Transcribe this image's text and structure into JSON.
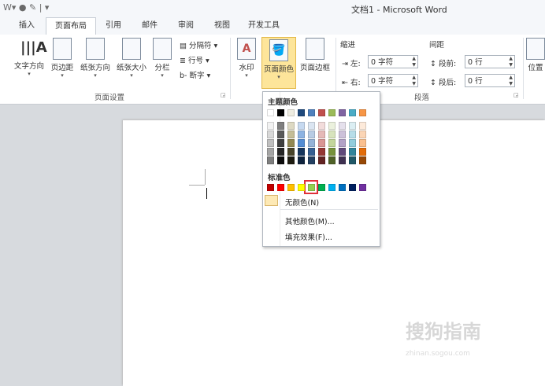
{
  "window": {
    "title": "文档1 - Microsoft Word",
    "qat_glyphs": "W▾ ● ✎ | ▾"
  },
  "tabs": [
    {
      "label": "插入",
      "active": false
    },
    {
      "label": "页面布局",
      "active": true
    },
    {
      "label": "引用",
      "active": false
    },
    {
      "label": "邮件",
      "active": false
    },
    {
      "label": "审阅",
      "active": false
    },
    {
      "label": "视图",
      "active": false
    },
    {
      "label": "开发工具",
      "active": false
    }
  ],
  "ribbon": {
    "page_setup": {
      "buttons": [
        "文字方向",
        "页边距",
        "纸张方向",
        "纸张大小",
        "分栏"
      ],
      "separator_label": "分隔符",
      "line_numbers_label": "行号",
      "hyphenation_label": "断字",
      "group_label": "页面设置"
    },
    "background": {
      "watermark_label": "水印",
      "page_color_label": "页面颜色",
      "page_border_label": "页面边框"
    },
    "paragraph": {
      "indent_label": "缩进",
      "left_label": "左:",
      "left_value": "0 字符",
      "right_label": "右:",
      "right_value": "0 字符",
      "spacing_label": "间距",
      "before_label": "段前:",
      "before_value": "0 行",
      "after_label": "段后:",
      "after_value": "0 行",
      "group_label": "段落"
    },
    "position_label": "位置"
  },
  "dropdown": {
    "theme_title": "主题颜色",
    "standard_title": "标准色",
    "no_color_label": "无颜色(N)",
    "more_colors_label": "其他颜色(M)...",
    "fill_effects_label": "填充效果(F)...",
    "theme_top": [
      "#ffffff",
      "#000000",
      "#eeece1",
      "#1f497d",
      "#4f81bd",
      "#c0504d",
      "#9bbb59",
      "#8064a2",
      "#4bacc6",
      "#f79646"
    ],
    "theme_shades": [
      [
        "#f2f2f2",
        "#7f7f7f",
        "#ddd9c3",
        "#c6d9f0",
        "#dbe5f1",
        "#f2dcdb",
        "#ebf1dd",
        "#e5e0ec",
        "#dbeef3",
        "#fdeada"
      ],
      [
        "#d8d8d8",
        "#595959",
        "#c4bd97",
        "#8db3e2",
        "#b8cce4",
        "#e5b9b7",
        "#d7e3bc",
        "#ccc1d9",
        "#b7dde8",
        "#fbd5b5"
      ],
      [
        "#bfbfbf",
        "#3f3f3f",
        "#938953",
        "#548dd4",
        "#95b3d7",
        "#d99694",
        "#c3d69b",
        "#b2a2c7",
        "#92cddc",
        "#fac08f"
      ],
      [
        "#a5a5a5",
        "#262626",
        "#494429",
        "#17365d",
        "#366092",
        "#953734",
        "#76923c",
        "#5f497a",
        "#31859b",
        "#e36c09"
      ],
      [
        "#7f7f7f",
        "#0c0c0c",
        "#1d1b10",
        "#0f243e",
        "#244061",
        "#632423",
        "#4f6128",
        "#3f3151",
        "#205867",
        "#974806"
      ]
    ],
    "standard": [
      "#c00000",
      "#ff0000",
      "#ffc000",
      "#ffff00",
      "#92d050",
      "#00b050",
      "#00b0f0",
      "#0070c0",
      "#002060",
      "#7030a0"
    ],
    "selected_standard_index": 4,
    "highlight_color": "#e0303a"
  },
  "watermark": {
    "text": "搜狗指南",
    "sub": "zhinan.sogou.com"
  }
}
